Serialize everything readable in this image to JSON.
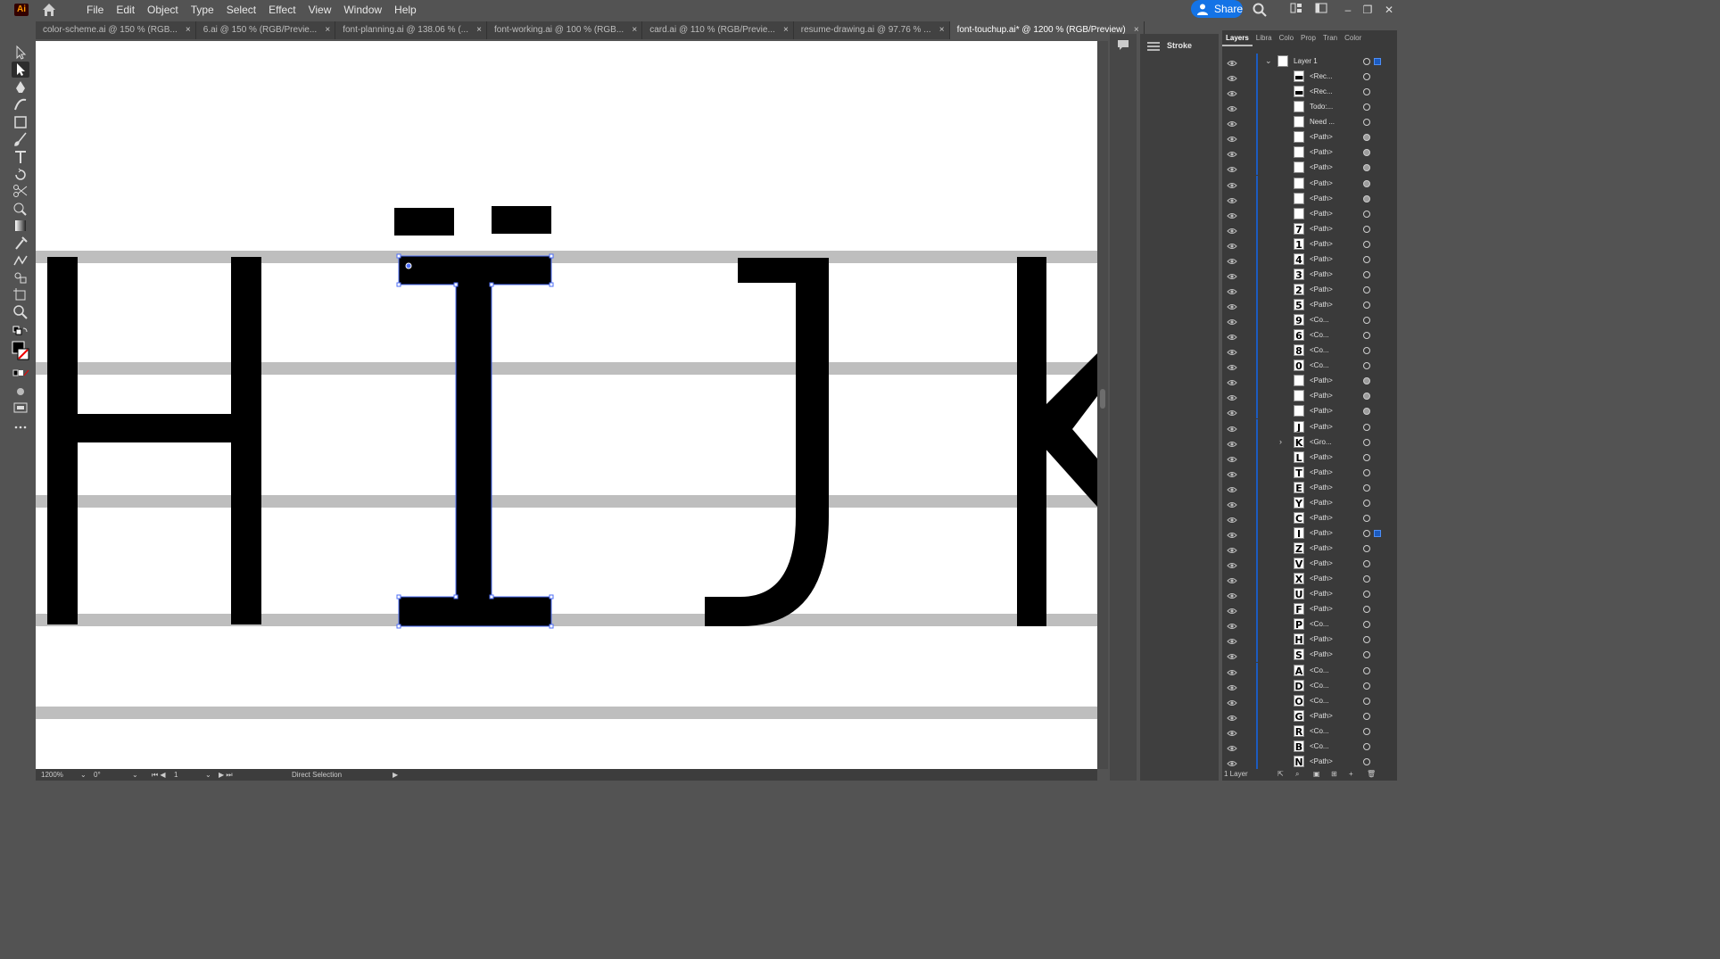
{
  "app": {
    "logo": "Ai"
  },
  "menu": [
    "File",
    "Edit",
    "Object",
    "Type",
    "Select",
    "Effect",
    "View",
    "Window",
    "Help"
  ],
  "share_label": "Share",
  "tabs": [
    {
      "label": "color-scheme.ai @ 150 % (RGB...",
      "active": false
    },
    {
      "label": "6.ai @ 150 % (RGB/Previe...",
      "active": false
    },
    {
      "label": "font-planning.ai @ 138.06 % (...",
      "active": false
    },
    {
      "label": "font-working.ai @ 100 % (RGB...",
      "active": false
    },
    {
      "label": "card.ai @ 110 % (RGB/Previe...",
      "active": false
    },
    {
      "label": "resume-drawing.ai @ 97.76 % ...",
      "active": false
    },
    {
      "label": "font-touchup.ai* @ 1200 % (RGB/Preview)",
      "active": true
    }
  ],
  "status": {
    "zoom": "1200%",
    "rotate": "0°",
    "artboard": "1",
    "tool": "Direct Selection"
  },
  "stroke_panel": {
    "label": "Stroke"
  },
  "layers_panel": {
    "tabs": [
      "Layers",
      "Libra",
      "Colo",
      "Prop",
      "Tran",
      "Color"
    ],
    "footer": "1 Layer",
    "rows": [
      {
        "glyph": "",
        "name": "Layer 1",
        "top": true
      },
      {
        "glyph": "▬",
        "name": "<Rec..."
      },
      {
        "glyph": "▬",
        "name": "<Rec..."
      },
      {
        "glyph": "",
        "name": "Todo:..."
      },
      {
        "glyph": "",
        "name": "Need ..."
      },
      {
        "glyph": "",
        "name": "<Path>",
        "filled": true
      },
      {
        "glyph": "",
        "name": "<Path>",
        "filled": true
      },
      {
        "glyph": "",
        "name": "<Path>",
        "filled": true
      },
      {
        "glyph": "",
        "name": "<Path>",
        "filled": true
      },
      {
        "glyph": "",
        "name": "<Path>",
        "filled": true
      },
      {
        "glyph": "",
        "name": "<Path>"
      },
      {
        "glyph": "7",
        "name": "<Path>"
      },
      {
        "glyph": "1",
        "name": "<Path>"
      },
      {
        "glyph": "4",
        "name": "<Path>"
      },
      {
        "glyph": "3",
        "name": "<Path>"
      },
      {
        "glyph": "2",
        "name": "<Path>"
      },
      {
        "glyph": "5",
        "name": "<Path>"
      },
      {
        "glyph": "9",
        "name": "<Co..."
      },
      {
        "glyph": "6",
        "name": "<Co..."
      },
      {
        "glyph": "8",
        "name": "<Co..."
      },
      {
        "glyph": "0",
        "name": "<Co..."
      },
      {
        "glyph": "",
        "name": "<Path>",
        "filled": true
      },
      {
        "glyph": "",
        "name": "<Path>",
        "filled": true
      },
      {
        "glyph": "",
        "name": "<Path>",
        "filled": true
      },
      {
        "glyph": "J",
        "name": "<Path>"
      },
      {
        "glyph": "K",
        "name": "<Gro...",
        "group": true
      },
      {
        "glyph": "L",
        "name": "<Path>"
      },
      {
        "glyph": "T",
        "name": "<Path>"
      },
      {
        "glyph": "E",
        "name": "<Path>"
      },
      {
        "glyph": "Y",
        "name": "<Path>"
      },
      {
        "glyph": "C",
        "name": "<Path>"
      },
      {
        "glyph": "I",
        "name": "<Path>",
        "selected": true
      },
      {
        "glyph": "Z",
        "name": "<Path>"
      },
      {
        "glyph": "V",
        "name": "<Path>"
      },
      {
        "glyph": "X",
        "name": "<Path>"
      },
      {
        "glyph": "U",
        "name": "<Path>"
      },
      {
        "glyph": "F",
        "name": "<Path>"
      },
      {
        "glyph": "P",
        "name": "<Co..."
      },
      {
        "glyph": "H",
        "name": "<Path>"
      },
      {
        "glyph": "S",
        "name": "<Path>"
      },
      {
        "glyph": "A",
        "name": "<Co..."
      },
      {
        "glyph": "D",
        "name": "<Co..."
      },
      {
        "glyph": "O",
        "name": "<Co..."
      },
      {
        "glyph": "G",
        "name": "<Path>"
      },
      {
        "glyph": "R",
        "name": "<Co..."
      },
      {
        "glyph": "B",
        "name": "<Co..."
      },
      {
        "glyph": "N",
        "name": "<Path>"
      }
    ]
  },
  "colors": {
    "ui_bg": "#535353",
    "panel_bg": "#3a3a3a",
    "accent": "#1473e6",
    "selection": "#4d6ef7",
    "guide": "#bebebe"
  }
}
